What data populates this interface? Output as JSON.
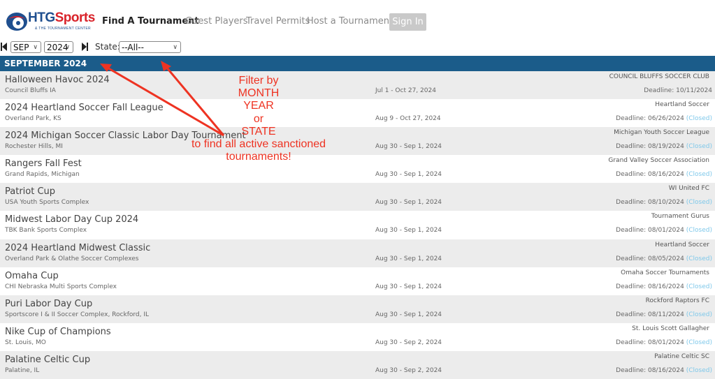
{
  "header": {
    "logo_text_blue": "HTG",
    "logo_text_red": "Sports",
    "logo_subtitle": "& THE TOURNAMENT CENTER",
    "nav": {
      "find": "Find A Tournament",
      "guest": "Guest Players",
      "travel": "Travel Permits",
      "host": "Host a Tournament"
    },
    "signin": "Sign In"
  },
  "filters": {
    "month": "SEP",
    "year": "2024",
    "state_label": "State:",
    "state_value": "--All--"
  },
  "month_header": "SEPTEMBER 2024",
  "closed_label": "(Closed)",
  "tournaments": [
    {
      "name": "Halloween Havoc 2024",
      "location": "Council Bluffs IA",
      "dates": "Jul 1 - Oct 27, 2024",
      "organizer": "COUNCIL BLUFFS SOCCER CLUB",
      "deadline": "Deadline: 10/11/2024",
      "closed": false
    },
    {
      "name": "2024 Heartland Soccer Fall League",
      "location": "Overland Park, KS",
      "dates": "Aug 9 - Oct 27, 2024",
      "organizer": "Heartland Soccer",
      "deadline": "Deadline: 06/26/2024",
      "closed": true
    },
    {
      "name": "2024 Michigan Soccer Classic Labor Day Tournament",
      "location": "Rochester Hills, MI",
      "dates": "Aug 30 - Sep 1, 2024",
      "organizer": "Michigan Youth Soccer League",
      "deadline": "Deadline: 08/19/2024",
      "closed": true
    },
    {
      "name": "Rangers Fall Fest",
      "location": "Grand Rapids, Michigan",
      "dates": "Aug 30 - Sep 1, 2024",
      "organizer": "Grand Valley Soccer Association",
      "deadline": "Deadline: 08/16/2024",
      "closed": true
    },
    {
      "name": "Patriot Cup",
      "location": "USA Youth Sports Complex",
      "dates": "Aug 30 - Sep 1, 2024",
      "organizer": "WI United FC",
      "deadline": "Deadline: 08/10/2024",
      "closed": true
    },
    {
      "name": "Midwest Labor Day Cup 2024",
      "location": "TBK Bank Sports Complex",
      "dates": "Aug 30 - Sep 1, 2024",
      "organizer": "Tournament Gurus",
      "deadline": "Deadline: 08/01/2024",
      "closed": true
    },
    {
      "name": "2024 Heartland Midwest Classic",
      "location": "Overland Park & Olathe Soccer Complexes",
      "dates": "Aug 30 - Sep 1, 2024",
      "organizer": "Heartland Soccer",
      "deadline": "Deadline: 08/05/2024",
      "closed": true
    },
    {
      "name": "Omaha Cup",
      "location": "CHI Nebraska Multi Sports Complex",
      "dates": "Aug 30 - Sep 1, 2024",
      "organizer": "Omaha Soccer Tournaments",
      "deadline": "Deadline: 08/16/2024",
      "closed": true
    },
    {
      "name": "Puri Labor Day Cup",
      "location": "Sportscore I & II Soccer Complex, Rockford, IL",
      "dates": "Aug 30 - Sep 1, 2024",
      "organizer": "Rockford Raptors FC",
      "deadline": "Deadline: 08/11/2024",
      "closed": true
    },
    {
      "name": "Nike Cup of Champions",
      "location": "St. Louis, MO",
      "dates": "Aug 30 - Sep 2, 2024",
      "organizer": "St. Louis Scott Gallagher",
      "deadline": "Deadline: 08/01/2024",
      "closed": true
    },
    {
      "name": "Palatine Celtic Cup",
      "location": "Palatine, IL",
      "dates": "Aug 30 - Sep 2, 2024",
      "organizer": "Palatine Celtic SC",
      "deadline": "Deadline: 08/16/2024",
      "closed": true
    }
  ],
  "annotation": {
    "lines": [
      "Filter by",
      "MONTH",
      "YEAR",
      "or",
      "STATE",
      "to find all active sanctioned",
      "tournaments!"
    ],
    "color": "#ee3322"
  },
  "colors": {
    "brand_blue": "#1b5c8a",
    "closed": "#7ec8ea",
    "signin_bg": "#c9c9c9"
  }
}
